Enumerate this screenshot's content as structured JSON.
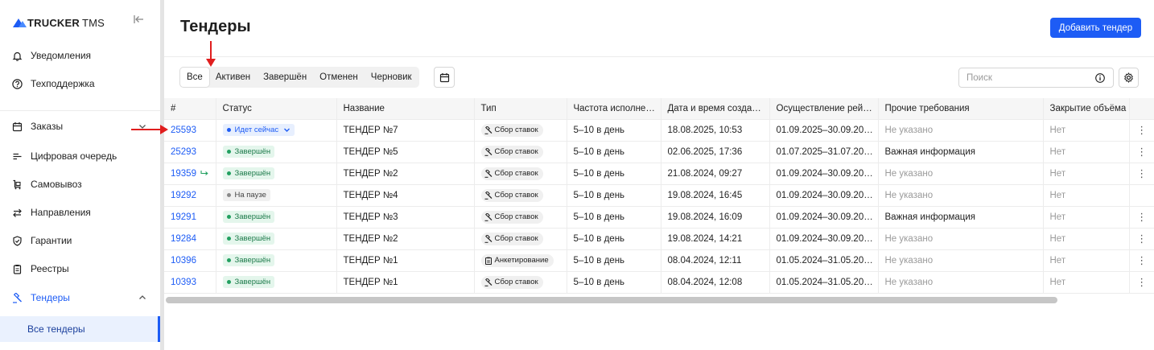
{
  "logo": {
    "brand": "TRUCKER",
    "suffix": "TMS"
  },
  "sidebar": {
    "top_items": [
      {
        "label": "Уведомления",
        "icon": "bell-icon"
      },
      {
        "label": "Техподдержка",
        "icon": "help-circle-icon"
      }
    ],
    "items": [
      {
        "label": "Заказы",
        "icon": "calendar-icon"
      },
      {
        "label": "Цифровая очередь",
        "icon": "queue-icon"
      },
      {
        "label": "Самовывоз",
        "icon": "cart-icon"
      },
      {
        "label": "Направления",
        "icon": "arrows-swap-icon"
      },
      {
        "label": "Гарантии",
        "icon": "shield-check-icon"
      },
      {
        "label": "Реестры",
        "icon": "clipboard-icon"
      },
      {
        "label": "Тендеры",
        "icon": "gavel-icon"
      }
    ],
    "sub_item": "Все тендеры"
  },
  "header": {
    "title": "Тендеры",
    "add_button": "Добавить тендер"
  },
  "tabs": [
    "Все",
    "Активен",
    "Завершён",
    "Отменен",
    "Черновик"
  ],
  "search": {
    "placeholder": "Поиск"
  },
  "table": {
    "columns": [
      "#",
      "Статус",
      "Название",
      "Тип",
      "Частота исполне…",
      "Дата и время созда…",
      "Осуществление рей…",
      "Прочие требования",
      "Закрытие объёма"
    ],
    "rows": [
      {
        "id": "25593",
        "status": "Идет сейчас",
        "status_kind": "live",
        "name": "ТЕНДЕР №7",
        "type": "Сбор ставок",
        "type_kind": "bid",
        "freq": "5–10 в день",
        "created": "18.08.2025, 10:53",
        "period": "01.09.2025–30.09.20…",
        "req": "Не указано",
        "req_muted": true,
        "close": "Нет",
        "kebab": true,
        "repeat": false
      },
      {
        "id": "25293",
        "status": "Завершён",
        "status_kind": "done",
        "name": "ТЕНДЕР №5",
        "type": "Сбор ставок",
        "type_kind": "bid",
        "freq": "5–10 в день",
        "created": "02.06.2025, 17:36",
        "period": "01.07.2025–31.07.20…",
        "req": "Важная информация",
        "req_muted": false,
        "close": "Нет",
        "kebab": true,
        "repeat": false
      },
      {
        "id": "19359",
        "status": "Завершён",
        "status_kind": "done",
        "name": "ТЕНДЕР №2",
        "type": "Сбор ставок",
        "type_kind": "bid",
        "freq": "5–10 в день",
        "created": "21.08.2024, 09:27",
        "period": "01.09.2024–30.09.20…",
        "req": "Не указано",
        "req_muted": true,
        "close": "Нет",
        "kebab": true,
        "repeat": true
      },
      {
        "id": "19292",
        "status": "На паузе",
        "status_kind": "pause",
        "name": "ТЕНДЕР №4",
        "type": "Сбор ставок",
        "type_kind": "bid",
        "freq": "5–10 в день",
        "created": "19.08.2024, 16:45",
        "period": "01.09.2024–30.09.20…",
        "req": "Не указано",
        "req_muted": true,
        "close": "Нет",
        "kebab": false,
        "repeat": false
      },
      {
        "id": "19291",
        "status": "Завершён",
        "status_kind": "done",
        "name": "ТЕНДЕР №3",
        "type": "Сбор ставок",
        "type_kind": "bid",
        "freq": "5–10 в день",
        "created": "19.08.2024, 16:09",
        "period": "01.09.2024–30.09.20…",
        "req": "Важная информация",
        "req_muted": false,
        "close": "Нет",
        "kebab": true,
        "repeat": false
      },
      {
        "id": "19284",
        "status": "Завершён",
        "status_kind": "done",
        "name": "ТЕНДЕР №2",
        "type": "Сбор ставок",
        "type_kind": "bid",
        "freq": "5–10 в день",
        "created": "19.08.2024, 14:21",
        "period": "01.09.2024–30.09.20…",
        "req": "Не указано",
        "req_muted": true,
        "close": "Нет",
        "kebab": true,
        "repeat": false
      },
      {
        "id": "10396",
        "status": "Завершён",
        "status_kind": "done",
        "name": "ТЕНДЕР №1",
        "type": "Анкетирование",
        "type_kind": "survey",
        "freq": "5–10 в день",
        "created": "08.04.2024, 12:11",
        "period": "01.05.2024–31.05.20…",
        "req": "Не указано",
        "req_muted": true,
        "close": "Нет",
        "kebab": true,
        "repeat": false
      },
      {
        "id": "10393",
        "status": "Завершён",
        "status_kind": "done",
        "name": "ТЕНДЕР №1",
        "type": "Сбор ставок",
        "type_kind": "bid",
        "freq": "5–10 в день",
        "created": "08.04.2024, 12:08",
        "period": "01.05.2024–31.05.20…",
        "req": "Не указано",
        "req_muted": true,
        "close": "Нет",
        "kebab": true,
        "repeat": false
      }
    ]
  },
  "colors": {
    "accent": "#1d5cf5",
    "success": "#22a060",
    "annotation": "#e01e1e"
  }
}
